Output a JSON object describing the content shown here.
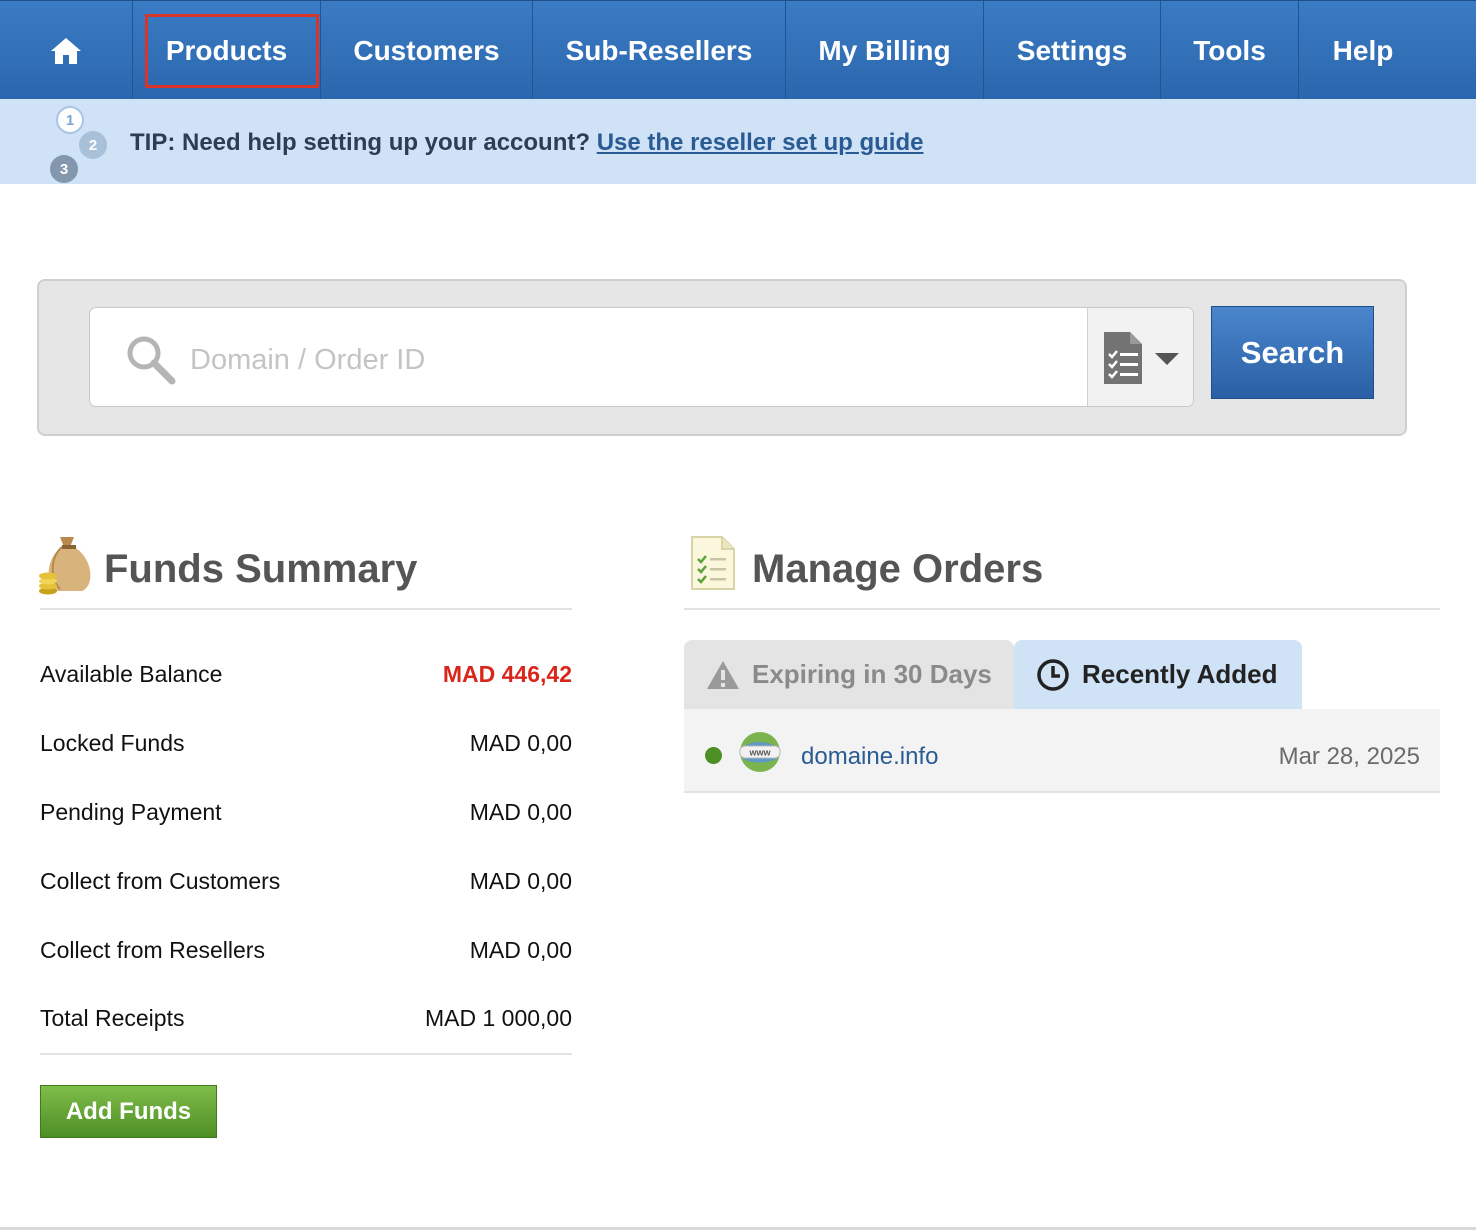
{
  "nav": {
    "home_icon": "home-icon",
    "items": [
      {
        "label": "Products"
      },
      {
        "label": "Customers"
      },
      {
        "label": "Sub-Resellers"
      },
      {
        "label": "My Billing"
      },
      {
        "label": "Settings"
      },
      {
        "label": "Tools"
      },
      {
        "label": "Help"
      }
    ],
    "highlighted": "Products",
    "highlight_color": "#d9342b"
  },
  "tip": {
    "steps": [
      "1",
      "2",
      "3"
    ],
    "text": "TIP: Need help setting up your account?",
    "link": "Use the reseller set up guide"
  },
  "search": {
    "placeholder": "Domain / Order ID",
    "button": "Search",
    "type_icon": "document-list-icon"
  },
  "funds": {
    "title": "Funds Summary",
    "icon": "money-bag-icon",
    "rows": [
      {
        "label": "Available Balance",
        "value": "MAD 446,42"
      },
      {
        "label": "Locked Funds",
        "value": "MAD 0,00"
      },
      {
        "label": "Pending Payment",
        "value": "MAD 0,00"
      },
      {
        "label": "Collect from Customers",
        "value": "MAD 0,00"
      },
      {
        "label": "Collect from Resellers",
        "value": "MAD 0,00"
      },
      {
        "label": "Total Receipts",
        "value": "MAD 1 000,00"
      }
    ],
    "add_button": "Add Funds",
    "balance_color": "#d9261c"
  },
  "orders": {
    "title": "Manage Orders",
    "icon": "checklist-document-icon",
    "tabs": [
      {
        "label": "Expiring in 30 Days",
        "icon": "warning-icon"
      },
      {
        "label": "Recently Added",
        "icon": "clock-icon"
      }
    ],
    "active_tab": "Recently Added",
    "items": [
      {
        "domain": "domaine.info",
        "date": "Mar 28, 2025",
        "status_color": "#4e8f25",
        "icon": "www-globe-icon"
      }
    ]
  }
}
